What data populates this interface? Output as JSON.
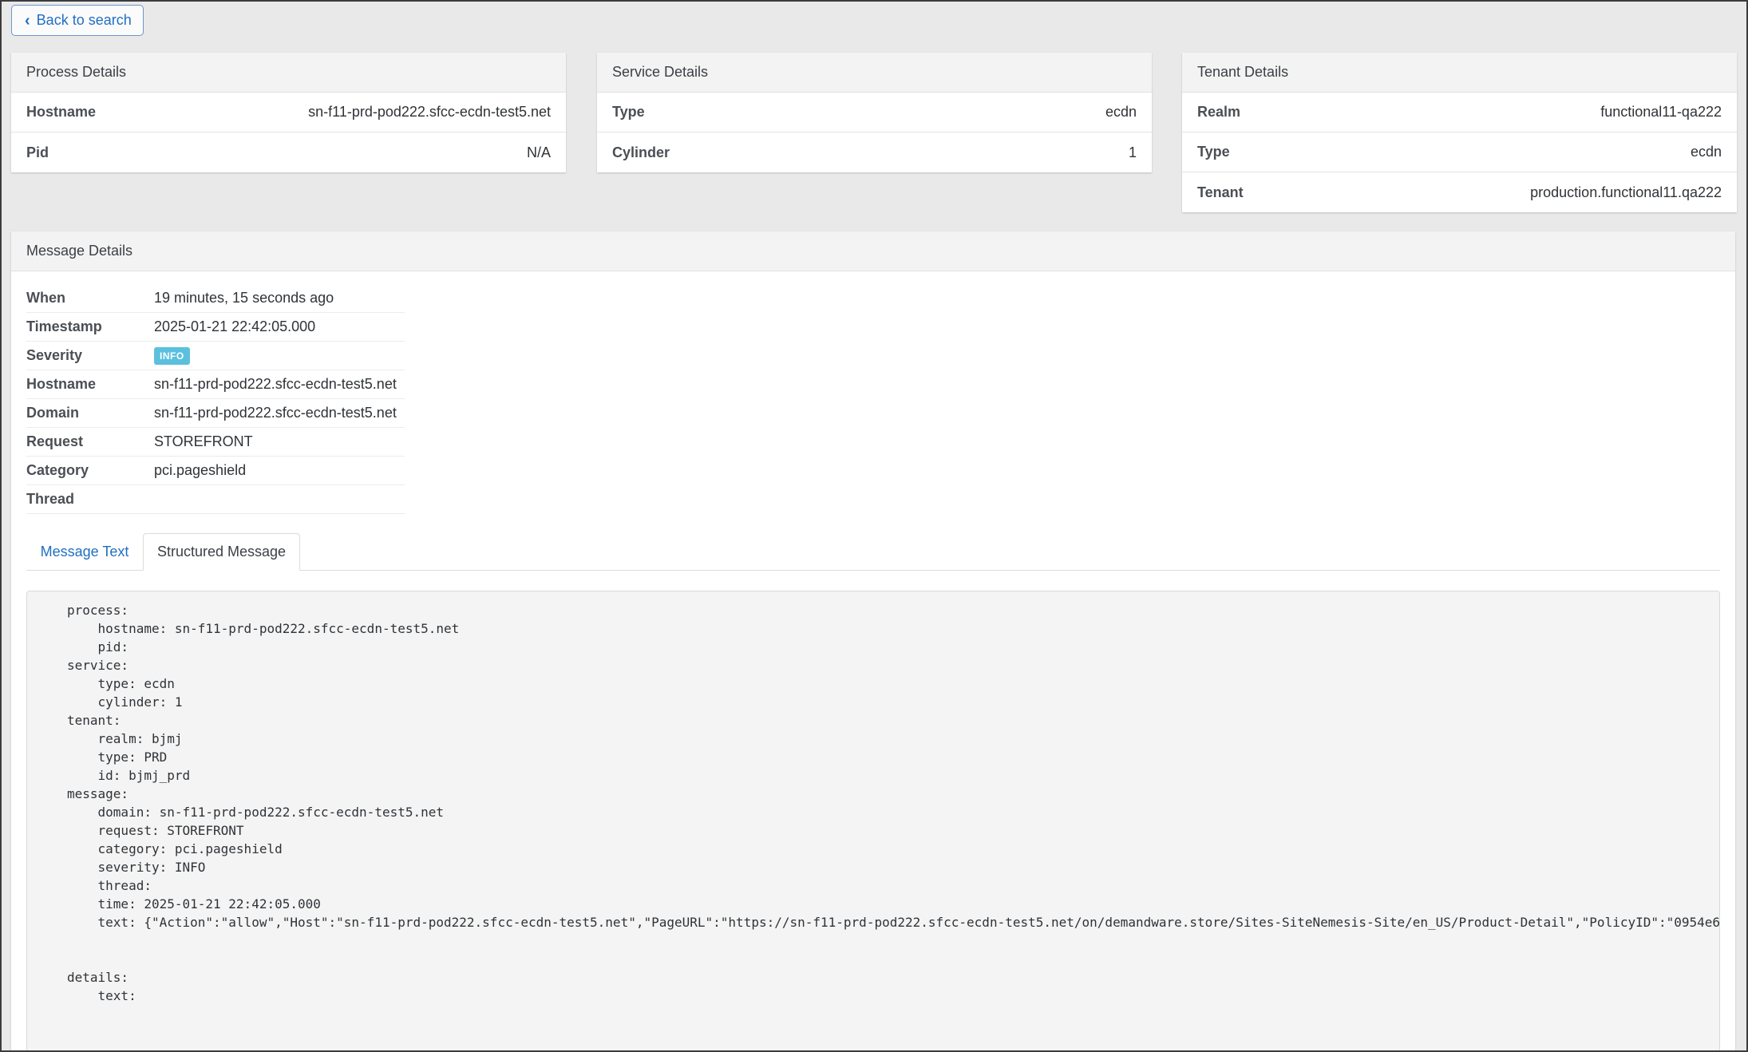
{
  "back_button": {
    "label": "Back to search"
  },
  "process_card": {
    "title": "Process Details",
    "rows": [
      {
        "key": "Hostname",
        "value": "sn-f11-prd-pod222.sfcc-ecdn-test5.net"
      },
      {
        "key": "Pid",
        "value": "N/A"
      }
    ]
  },
  "service_card": {
    "title": "Service Details",
    "rows": [
      {
        "key": "Type",
        "value": "ecdn"
      },
      {
        "key": "Cylinder",
        "value": "1"
      }
    ]
  },
  "tenant_card": {
    "title": "Tenant Details",
    "rows": [
      {
        "key": "Realm",
        "value": "functional11-qa222"
      },
      {
        "key": "Type",
        "value": "ecdn"
      },
      {
        "key": "Tenant",
        "value": "production.functional11.qa222"
      }
    ]
  },
  "message_card": {
    "title": "Message Details",
    "rows": [
      {
        "key": "When",
        "value": "19 minutes, 15 seconds ago"
      },
      {
        "key": "Timestamp",
        "value": "2025-01-21 22:42:05.000"
      },
      {
        "key": "Severity",
        "value": "INFO"
      },
      {
        "key": "Hostname",
        "value": "sn-f11-prd-pod222.sfcc-ecdn-test5.net"
      },
      {
        "key": "Domain",
        "value": "sn-f11-prd-pod222.sfcc-ecdn-test5.net"
      },
      {
        "key": "Request",
        "value": "STOREFRONT"
      },
      {
        "key": "Category",
        "value": "pci.pageshield"
      },
      {
        "key": "Thread",
        "value": ""
      }
    ],
    "severity_color": "#5bc0de",
    "tabs": [
      {
        "label": "Message Text",
        "active": false
      },
      {
        "label": "Structured Message",
        "active": true
      }
    ],
    "structured_message": "process:\n    hostname: sn-f11-prd-pod222.sfcc-ecdn-test5.net\n    pid:\nservice:\n    type: ecdn\n    cylinder: 1\ntenant:\n    realm: bjmj\n    type: PRD\n    id: bjmj_prd\nmessage:\n    domain: sn-f11-prd-pod222.sfcc-ecdn-test5.net\n    request: STOREFRONT\n    category: pci.pageshield\n    severity: INFO\n    thread:\n    time: 2025-01-21 22:42:05.000\n    text: {\"Action\":\"allow\",\"Host\":\"sn-f11-prd-pod222.sfcc-ecdn-test5.net\",\"PageURL\":\"https://sn-f11-prd-pod222.sfcc-ecdn-test5.net/on/demandware.store/Sites-SiteNemesis-Site/en_US/Product-Detail\",\"PolicyID\":\"0954e6\n\n\ndetails:\n    text:"
  },
  "colors": {
    "page_bg": "#e9e9e9",
    "link_blue": "#1f6fc2",
    "card_header_bg": "#f3f3f3",
    "code_bg": "#f4f4f4"
  }
}
